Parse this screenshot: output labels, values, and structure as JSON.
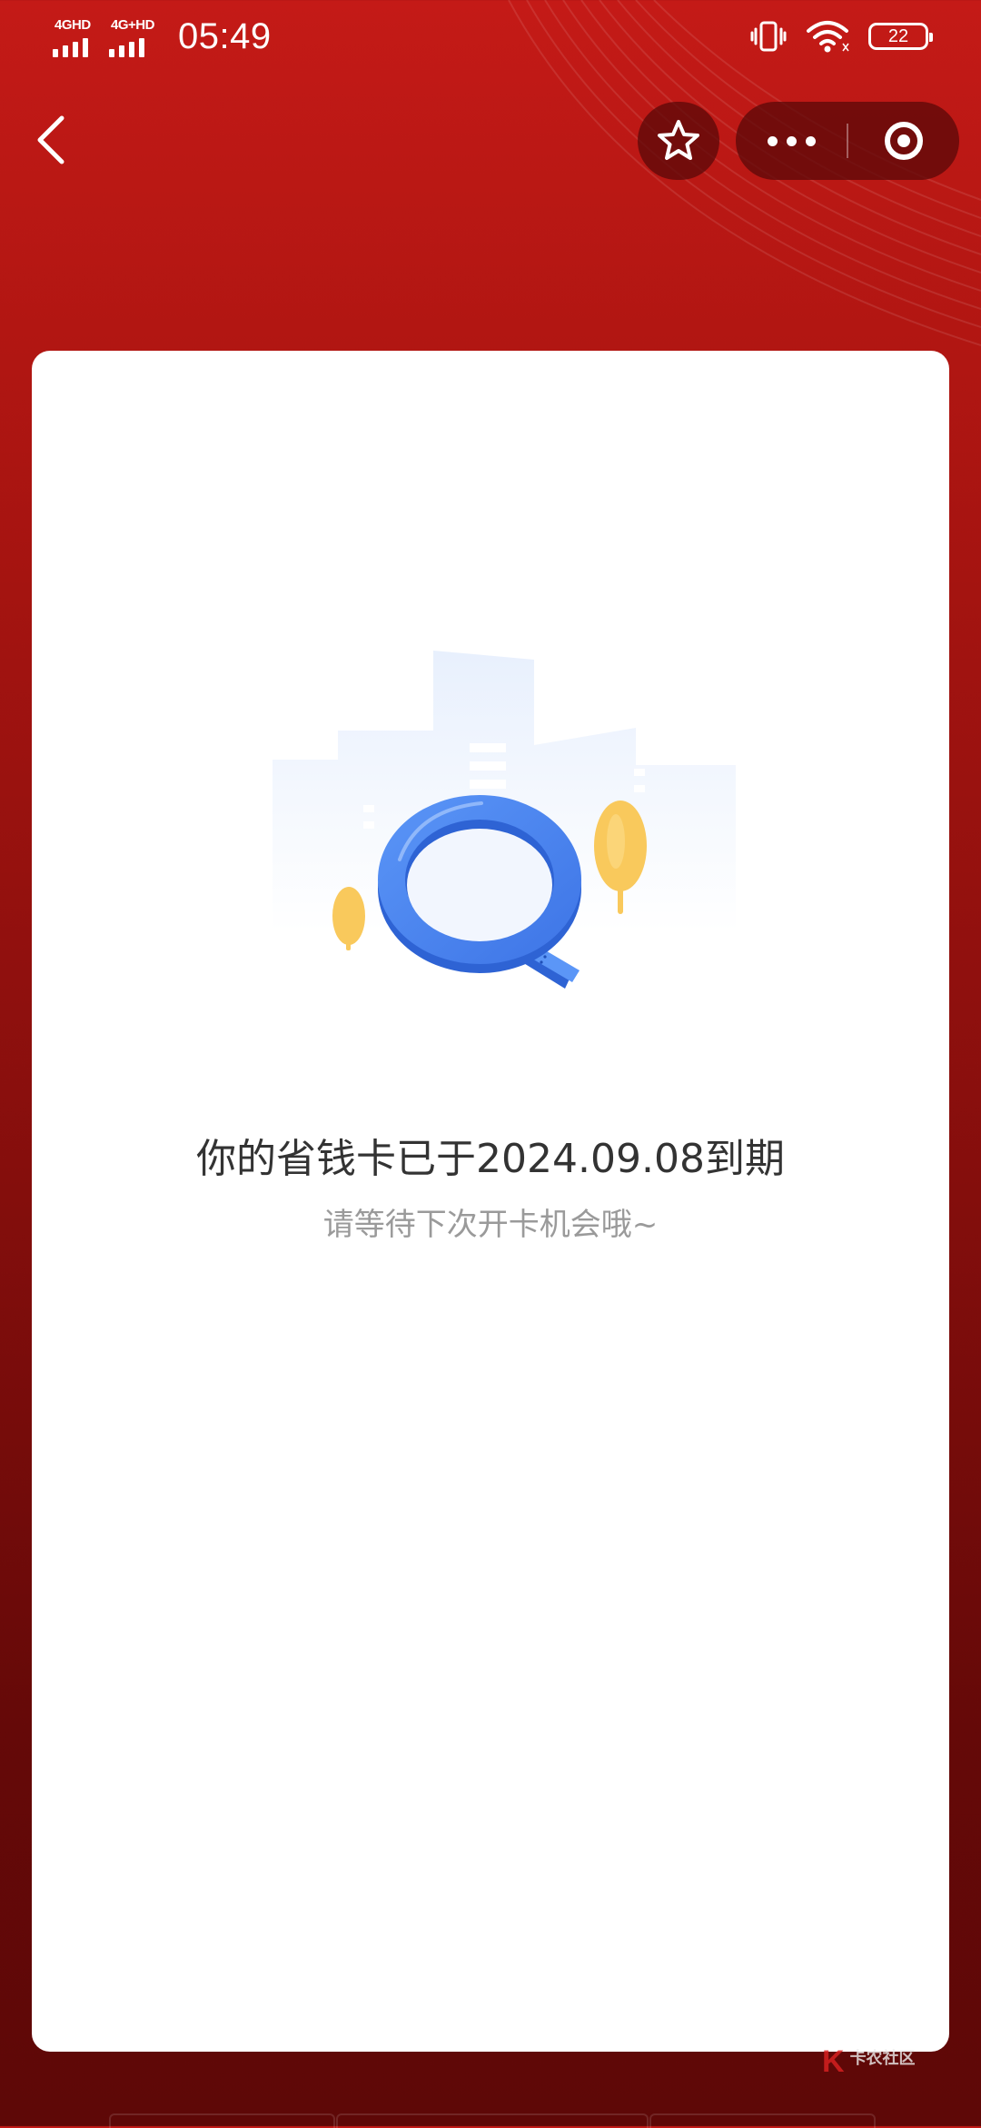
{
  "status_bar": {
    "sim1_network": "4GHD",
    "sim2_network": "4G+HD",
    "time": "05:49",
    "battery": "22"
  },
  "nav": {
    "back_icon": "chevron-left-icon",
    "favorite_icon": "star-icon",
    "more_icon": "more-dots-icon",
    "close_icon": "target-close-icon"
  },
  "card": {
    "title": "你的省钱卡已于2024.09.08到期",
    "subtitle": "请等待下次开卡机会哦~"
  },
  "watermark": {
    "logo": "K",
    "name": "卡农社区"
  },
  "colors": {
    "header_red": "#c41a17",
    "bottom_dark_red": "#5e0807",
    "magnifier_blue": "#4d88f2",
    "tree_yellow": "#f9c95c"
  }
}
